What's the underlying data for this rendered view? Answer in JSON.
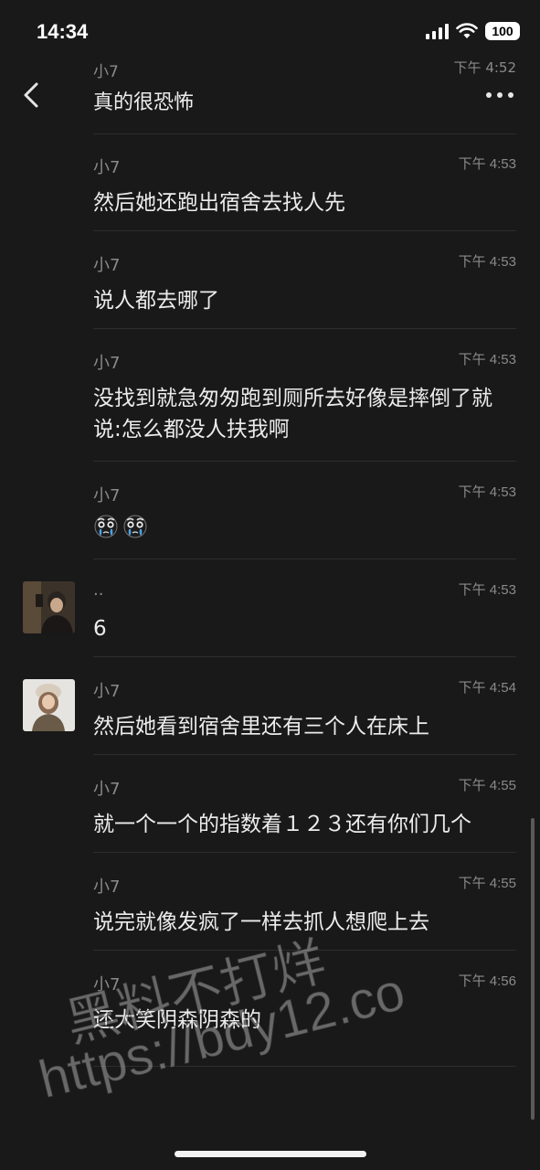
{
  "status_bar": {
    "time": "14:34",
    "battery": "100"
  },
  "header": {
    "title": "真的很恐怖",
    "peek_sender": "小7",
    "peek_time": "下午 4:52"
  },
  "messages": [
    {
      "sender": "小7",
      "time": "下午 4:53",
      "text": "然后她还跑出宿舍去找人先"
    },
    {
      "sender": "小7",
      "time": "下午 4:53",
      "text": "说人都去哪了"
    },
    {
      "sender": "小7",
      "time": "下午 4:53",
      "text": "没找到就急匆匆跑到厕所去好像是摔倒了就说:怎么都没人扶我啊"
    },
    {
      "sender": "小7",
      "time": "下午 4:53",
      "emoji": [
        "sob-emoji",
        "sob-emoji"
      ]
    },
    {
      "sender": "..",
      "time": "下午 4:53",
      "text": "6",
      "avatar": "male-avatar"
    },
    {
      "sender": "小7",
      "time": "下午 4:54",
      "text": "然后她看到宿舍里还有三个人在床上",
      "avatar": "female-avatar"
    },
    {
      "sender": "小7",
      "time": "下午 4:55",
      "text": "就一个一个的指数着１２３还有你们几个"
    },
    {
      "sender": "小7",
      "time": "下午 4:55",
      "text": "说完就像发疯了一样去抓人想爬上去"
    },
    {
      "sender": "小7",
      "time": "下午 4:56",
      "text": "还大笑阴森阴森的"
    }
  ],
  "watermark": {
    "line1": "黑料不打烊",
    "line2": "https://bdy12.co"
  },
  "colors": {
    "background": "#191919",
    "text": "#ececec",
    "meta": "#8a8a8a",
    "divider": "#2d2d2d"
  }
}
